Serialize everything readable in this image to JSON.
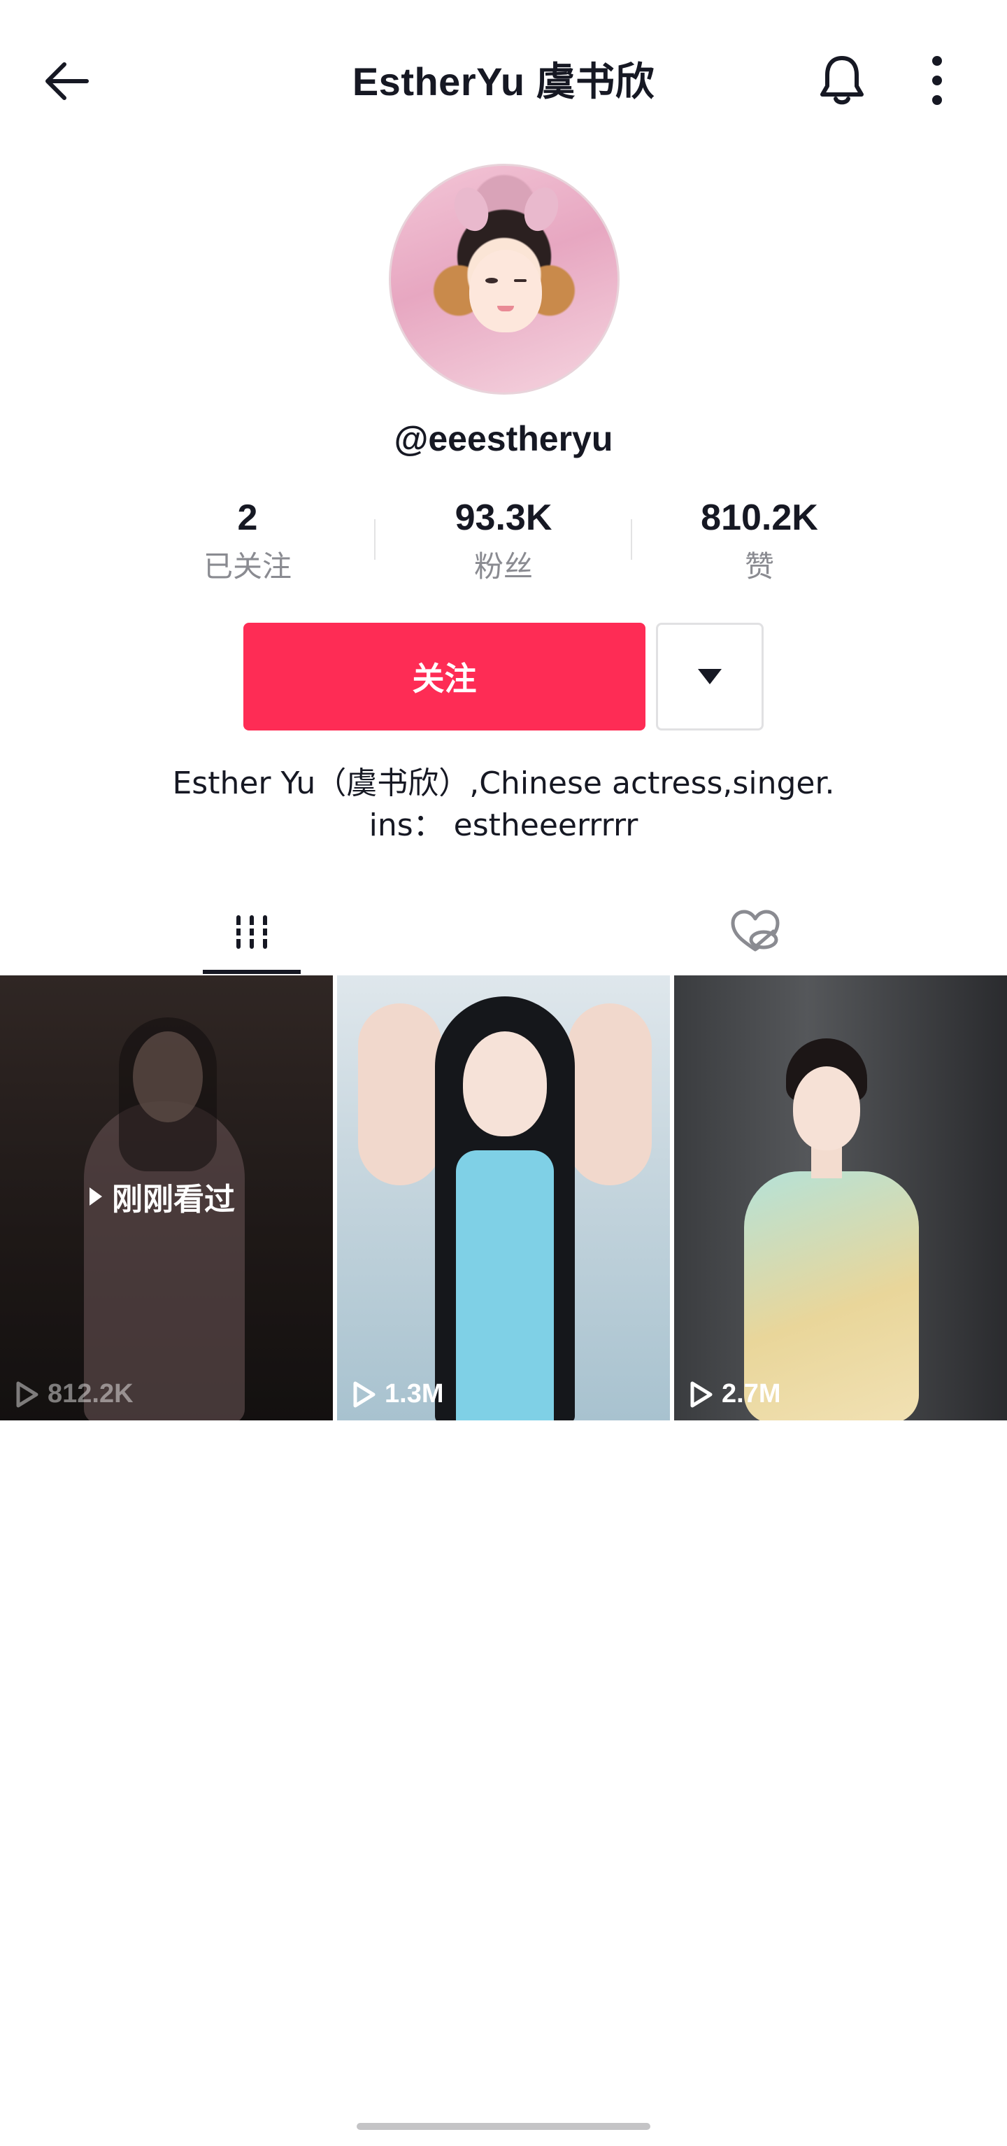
{
  "header": {
    "title": "EstherYu 虞书欣",
    "back_icon": "arrow-left-icon",
    "bell_icon": "bell-icon",
    "more_icon": "more-vertical-icon"
  },
  "profile": {
    "username": "@eeestheryu",
    "stats": [
      {
        "value": "2",
        "label": "已关注"
      },
      {
        "value": "93.3K",
        "label": "粉丝"
      },
      {
        "value": "810.2K",
        "label": "赞"
      }
    ],
    "follow_label": "关注",
    "bio_line1": "Esther Yu（虞书欣）,Chinese actress,singer.",
    "bio_line2": "ins： estheeerrrrr"
  },
  "tabs": [
    {
      "name": "videos",
      "icon": "grid-bars-icon",
      "active": true
    },
    {
      "name": "liked",
      "icon": "heart-hidden-icon",
      "active": false
    }
  ],
  "videos": [
    {
      "views": "812.2K",
      "badge": "刚刚看过"
    },
    {
      "views": "1.3M"
    },
    {
      "views": "2.7M"
    }
  ],
  "colors": {
    "accent": "#fe2c55",
    "text": "#161823",
    "muted": "#8a8b91"
  }
}
